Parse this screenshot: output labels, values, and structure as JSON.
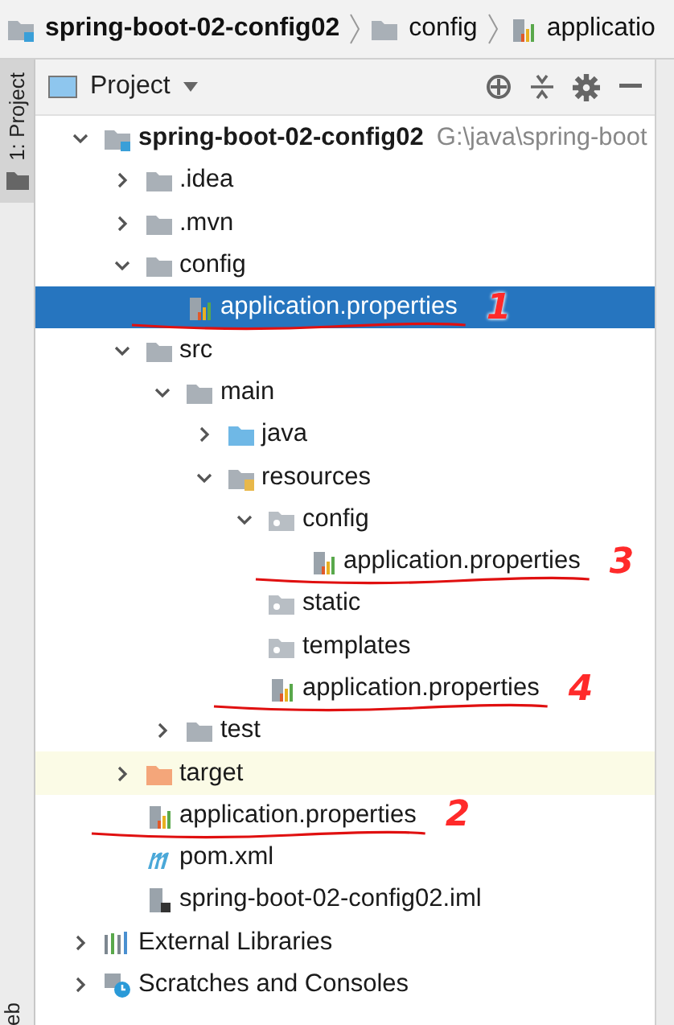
{
  "breadcrumbs": [
    {
      "label": "spring-boot-02-config02",
      "kind": "module"
    },
    {
      "label": "config",
      "kind": "folder"
    },
    {
      "label": "applicatio",
      "kind": "properties"
    }
  ],
  "side_strip": {
    "tab": "1: Project",
    "bottom_tab": "eb"
  },
  "panel": {
    "title": "Project"
  },
  "tree": [
    {
      "label": "spring-boot-02-config02",
      "kind": "module",
      "path": "G:\\java\\spring-boot",
      "expanded": true,
      "selected": false,
      "highlighted": false,
      "children": [
        {
          "label": ".idea",
          "kind": "folder",
          "expanded": false,
          "selected": false,
          "highlighted": false
        },
        {
          "label": ".mvn",
          "kind": "folder",
          "expanded": false,
          "selected": false,
          "highlighted": false
        },
        {
          "label": "config",
          "kind": "folder",
          "expanded": true,
          "selected": false,
          "highlighted": false,
          "children": [
            {
              "label": "application.properties",
              "kind": "properties",
              "selected": true,
              "highlighted": false,
              "annotation": "1"
            }
          ]
        },
        {
          "label": "src",
          "kind": "folder",
          "expanded": true,
          "selected": false,
          "highlighted": false,
          "children": [
            {
              "label": "main",
              "kind": "folder",
              "expanded": true,
              "selected": false,
              "highlighted": false,
              "children": [
                {
                  "label": "java",
                  "kind": "source",
                  "expanded": false,
                  "selected": false,
                  "highlighted": false
                },
                {
                  "label": "resources",
                  "kind": "resources",
                  "expanded": true,
                  "selected": false,
                  "highlighted": false,
                  "children": [
                    {
                      "label": "config",
                      "kind": "package",
                      "expanded": true,
                      "selected": false,
                      "highlighted": false,
                      "children": [
                        {
                          "label": "application.properties",
                          "kind": "properties",
                          "selected": false,
                          "highlighted": false,
                          "annotation": "3"
                        }
                      ]
                    },
                    {
                      "label": "static",
                      "kind": "package",
                      "selected": false,
                      "highlighted": false
                    },
                    {
                      "label": "templates",
                      "kind": "package",
                      "selected": false,
                      "highlighted": false
                    },
                    {
                      "label": "application.properties",
                      "kind": "properties",
                      "selected": false,
                      "highlighted": false,
                      "annotation": "4"
                    }
                  ]
                }
              ]
            },
            {
              "label": "test",
              "kind": "folder",
              "expanded": false,
              "selected": false,
              "highlighted": false
            }
          ]
        },
        {
          "label": "target",
          "kind": "excluded",
          "expanded": false,
          "selected": false,
          "highlighted": true
        },
        {
          "label": "application.properties",
          "kind": "properties",
          "selected": false,
          "highlighted": false,
          "annotation": "2"
        },
        {
          "label": "pom.xml",
          "kind": "maven",
          "selected": false,
          "highlighted": false
        },
        {
          "label": "spring-boot-02-config02.iml",
          "kind": "iml",
          "selected": false,
          "highlighted": false
        }
      ]
    },
    {
      "label": "External Libraries",
      "kind": "libraries",
      "expanded": false,
      "selected": false,
      "highlighted": false
    },
    {
      "label": "Scratches and Consoles",
      "kind": "scratches",
      "expanded": false,
      "selected": false,
      "highlighted": false
    }
  ]
}
